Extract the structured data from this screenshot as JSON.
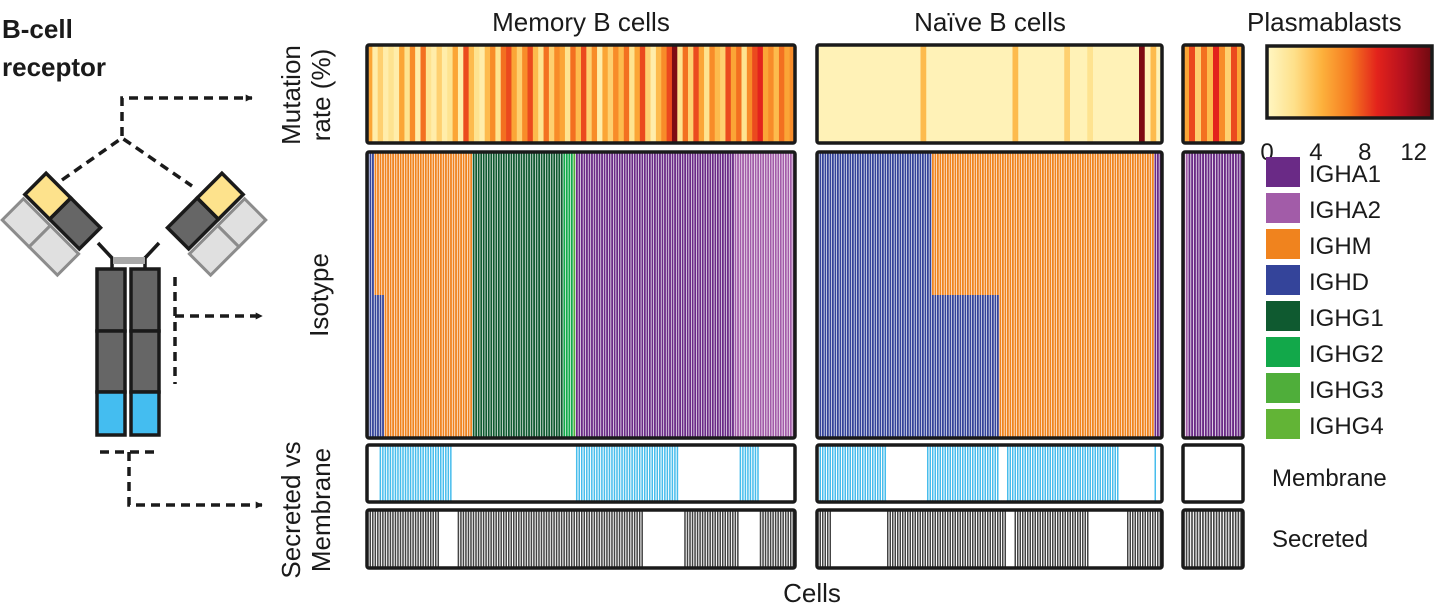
{
  "figure": {
    "schematic_title_line1": "B-cell",
    "schematic_title_line2": "receptor",
    "panel_titles": [
      "Memory B cells",
      "Naïve B cells",
      "Plasmablasts"
    ],
    "row_labels": {
      "mutation_line1": "Mutation",
      "mutation_line2": "rate (%)",
      "isotype": "Isotype",
      "secmem_line1": "Secreted vs",
      "secmem_line2": "Membrane"
    },
    "x_label": "Cells",
    "membrane_label": "Membrane",
    "secreted_label": "Secreted"
  },
  "chart_data": {
    "type": "heatmap",
    "xlabel": "Cells",
    "colorbar": {
      "range": [
        0,
        13.5
      ],
      "ticks": [
        "0",
        "4",
        "8",
        "12"
      ],
      "colors": [
        "#fff7c4",
        "#fee08a",
        "#fdb13c",
        "#f57a20",
        "#e3231c",
        "#b4101e",
        "#6e0a10"
      ]
    },
    "isotype_colors": {
      "IGHA1": "#6a2a86",
      "IGHA2": "#a25ca8",
      "IGHM": "#f0831e",
      "IGHD": "#34449a",
      "IGHG1": "#0f5a30",
      "IGHG2": "#12a84a",
      "IGHG3": "#4fae3a",
      "IGHG4": "#62b436"
    },
    "isotype_legend": [
      "IGHA1",
      "IGHA2",
      "IGHM",
      "IGHD",
      "IGHG1",
      "IGHG2",
      "IGHG3",
      "IGHG4"
    ],
    "membrane_color": "#47bdec",
    "secreted_color": "#444444",
    "panels": [
      {
        "name": "Memory B cells",
        "mutation_rate": [
          5,
          1,
          3,
          1,
          2,
          1,
          5,
          2,
          6,
          1,
          7,
          2,
          1,
          3,
          1,
          2,
          5,
          1,
          8,
          4,
          2,
          1,
          4,
          6,
          2,
          7,
          8,
          5,
          3,
          6,
          8,
          4,
          2,
          7,
          3,
          6,
          5,
          2,
          7,
          4,
          8,
          3,
          6,
          1,
          5,
          3,
          6,
          4,
          7,
          2,
          5,
          8,
          3,
          1,
          4,
          6,
          8,
          13,
          2,
          7,
          3,
          8,
          5,
          2,
          6,
          4,
          3,
          8,
          5,
          7,
          2,
          6,
          8,
          9,
          5,
          6,
          4,
          7,
          5,
          6
        ],
        "isotype": [
          {
            "isotype": "IGHD",
            "from": 0.0,
            "to": 0.02,
            "rows": "all"
          },
          {
            "isotype": "IGHM",
            "from": 0.02,
            "to": 0.04,
            "rows": "top"
          },
          {
            "isotype": "IGHD",
            "from": 0.02,
            "to": 0.04,
            "rows": "bottom"
          },
          {
            "isotype": "IGHM",
            "from": 0.04,
            "to": 0.25,
            "rows": "all"
          },
          {
            "isotype": "IGHG1",
            "from": 0.25,
            "to": 0.46,
            "rows": "all"
          },
          {
            "isotype": "IGHG2",
            "from": 0.46,
            "to": 0.48,
            "rows": "all"
          },
          {
            "isotype": "IGHG3",
            "from": 0.48,
            "to": 0.49,
            "rows": "all"
          },
          {
            "isotype": "IGHA1",
            "from": 0.49,
            "to": 0.86,
            "rows": "all"
          },
          {
            "isotype": "IGHA2",
            "from": 0.86,
            "to": 1.0,
            "rows": "all"
          }
        ],
        "membrane": [
          [
            0.0,
            0.005
          ],
          [
            0.03,
            0.2
          ],
          [
            0.49,
            0.73
          ],
          [
            0.87,
            0.92
          ]
        ],
        "secreted": [
          [
            0.0,
            0.17
          ],
          [
            0.21,
            0.65
          ],
          [
            0.74,
            0.87
          ],
          [
            0.92,
            1.0
          ]
        ]
      },
      {
        "name": "Naïve B cells",
        "mutation_rate": [
          0.5,
          0.5,
          0.5,
          0.5,
          0.5,
          0.5,
          0.5,
          0.5,
          0.5,
          0.5,
          0.5,
          0.5,
          0.5,
          0.5,
          0.5,
          0.5,
          0.5,
          0.5,
          4,
          0.5,
          0.5,
          0.5,
          0.5,
          0.5,
          0.5,
          0.5,
          0.5,
          0.5,
          0.5,
          0.5,
          0.5,
          0.5,
          0.5,
          0.5,
          4,
          0.5,
          0.5,
          0.5,
          0.5,
          0.5,
          0.5,
          0.5,
          0.5,
          3,
          0.5,
          0.5,
          0.5,
          2,
          0.5,
          0.5,
          0.5,
          0.5,
          0.5,
          0.5,
          0.5,
          0.5,
          13,
          0.5,
          4,
          0.5
        ],
        "isotype": [
          {
            "isotype": "IGHD",
            "from": 0.0,
            "to": 0.33,
            "rows": "all"
          },
          {
            "isotype": "IGHM",
            "from": 0.33,
            "to": 0.53,
            "rows": "top"
          },
          {
            "isotype": "IGHD",
            "from": 0.33,
            "to": 0.53,
            "rows": "bottom"
          },
          {
            "isotype": "IGHM",
            "from": 0.53,
            "to": 0.98,
            "rows": "all"
          },
          {
            "isotype": "IGHA1",
            "from": 0.98,
            "to": 1.0,
            "rows": "all"
          }
        ],
        "membrane": [
          [
            0.0,
            0.2
          ],
          [
            0.32,
            0.53
          ],
          [
            0.55,
            0.88
          ],
          [
            0.975,
            0.985
          ]
        ],
        "secreted": [
          [
            0.0,
            0.04
          ],
          [
            0.2,
            0.55
          ],
          [
            0.57,
            0.79
          ],
          [
            0.9,
            1.0
          ]
        ]
      },
      {
        "name": "Plasmablasts",
        "mutation_rate": [
          5,
          8,
          3,
          7,
          4,
          9,
          6,
          3,
          8,
          5
        ],
        "isotype": [
          {
            "isotype": "IGHA2",
            "from": 0.0,
            "to": 0.1,
            "rows": "all"
          },
          {
            "isotype": "IGHA1",
            "from": 0.1,
            "to": 1.0,
            "rows": "all"
          }
        ],
        "membrane": [],
        "secreted": [
          [
            0.0,
            1.0
          ]
        ]
      }
    ]
  }
}
